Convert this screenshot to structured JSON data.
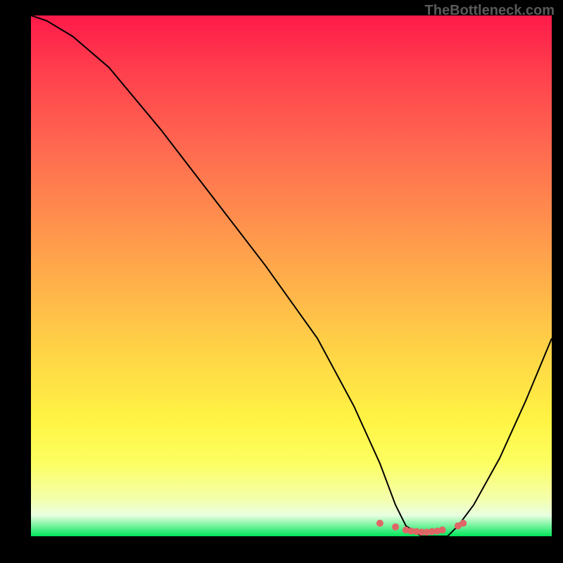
{
  "watermark": "TheBottleneck.com",
  "chart_data": {
    "type": "line",
    "title": "",
    "xlabel": "",
    "ylabel": "",
    "xlim": [
      0,
      100
    ],
    "ylim": [
      0,
      100
    ],
    "series": [
      {
        "name": "bottleneck-curve",
        "x": [
          0,
          3,
          8,
          15,
          25,
          35,
          45,
          55,
          62,
          67,
          70,
          72,
          75,
          78,
          80,
          82,
          85,
          90,
          95,
          100
        ],
        "values": [
          100,
          99,
          96,
          90,
          78,
          65,
          52,
          38,
          25,
          14,
          6,
          2,
          0,
          0,
          0,
          2,
          6,
          15,
          26,
          38
        ]
      }
    ],
    "markers": {
      "name": "optimal-range-dots",
      "x": [
        67,
        70,
        72,
        73,
        74,
        75,
        76,
        77,
        78,
        79,
        82,
        83
      ],
      "values": [
        2.5,
        1.8,
        1.2,
        1.0,
        0.9,
        0.8,
        0.8,
        0.9,
        1.0,
        1.2,
        2.0,
        2.5
      ]
    },
    "gradient_stops": [
      {
        "pos": 0,
        "color": "#ff1a4a"
      },
      {
        "pos": 10,
        "color": "#ff3d4d"
      },
      {
        "pos": 25,
        "color": "#ff6850"
      },
      {
        "pos": 38,
        "color": "#ff8c4e"
      },
      {
        "pos": 52,
        "color": "#ffb24a"
      },
      {
        "pos": 65,
        "color": "#ffd546"
      },
      {
        "pos": 78,
        "color": "#fff444"
      },
      {
        "pos": 86,
        "color": "#fcff62"
      },
      {
        "pos": 93,
        "color": "#f4ffae"
      },
      {
        "pos": 96,
        "color": "#e8ffe0"
      },
      {
        "pos": 100,
        "color": "#00e65a"
      }
    ],
    "marker_color": "#e06666",
    "line_color": "#000000"
  }
}
